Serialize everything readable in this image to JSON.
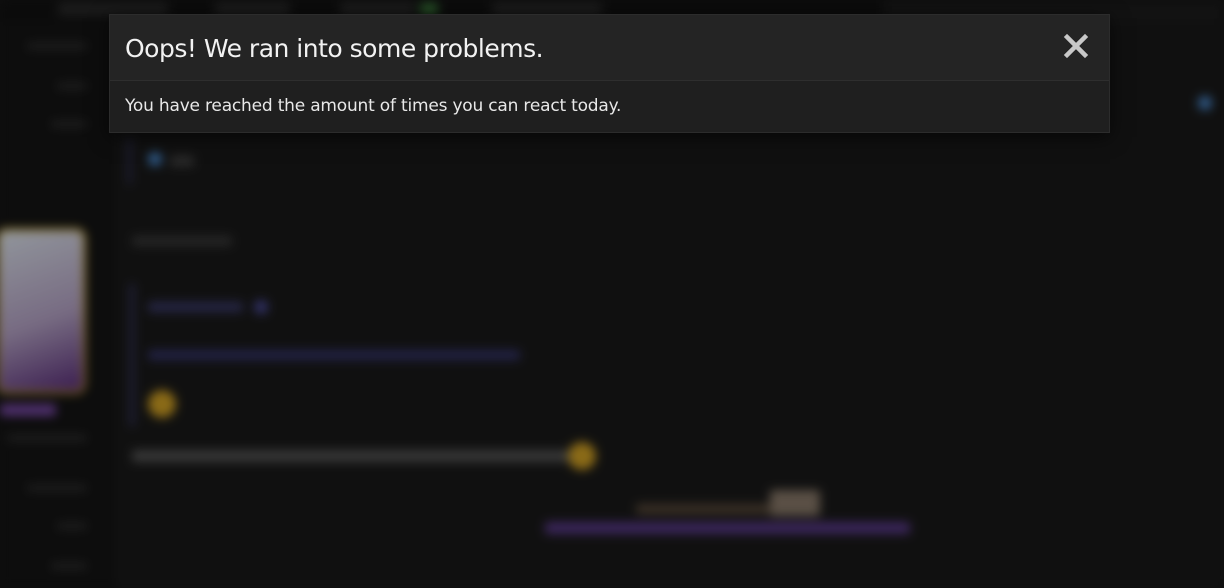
{
  "modal": {
    "title": "Oops! We ran into some problems.",
    "message": "You have reached the amount of times you can react today.",
    "close_icon": "close-icon"
  },
  "colors": {
    "modal_background": "#1f1f1f",
    "modal_header": "#242424",
    "text_primary": "#f2f2f2",
    "page_background": "#161616"
  }
}
